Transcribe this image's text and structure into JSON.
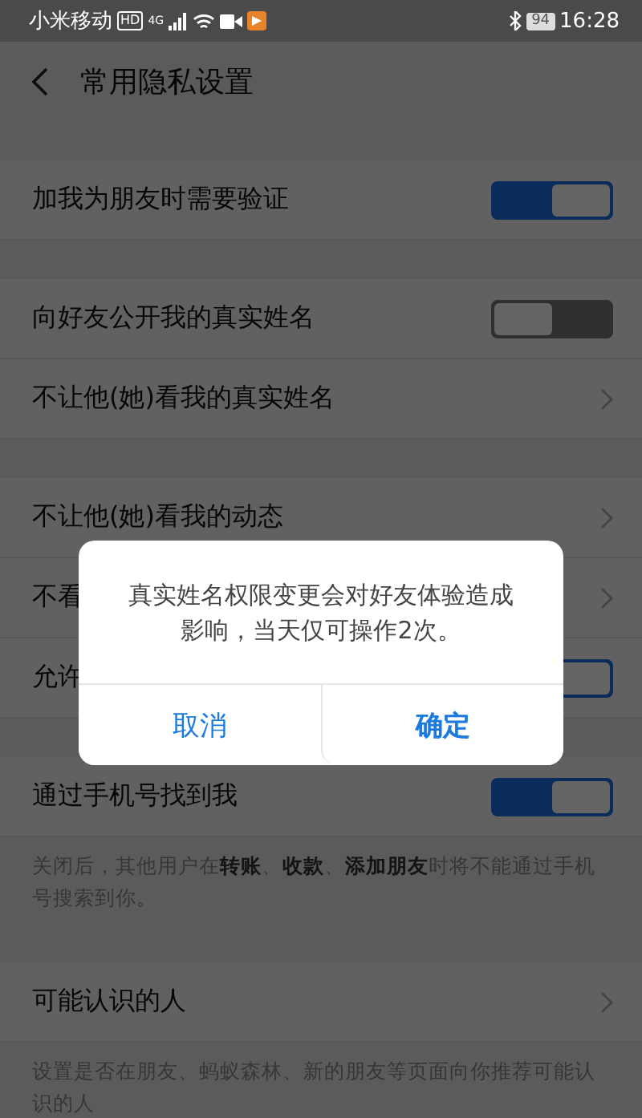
{
  "status_bar": {
    "carrier": "小米移动",
    "hd": "HD",
    "network": "4G",
    "battery": "94",
    "time": "16:28"
  },
  "header": {
    "title": "常用隐私设置"
  },
  "sections": [
    {
      "rows": [
        {
          "kind": "toggle",
          "label": "加我为朋友时需要验证",
          "on": true
        }
      ]
    },
    {
      "rows": [
        {
          "kind": "toggle",
          "label": "向好友公开我的真实姓名",
          "on": false
        },
        {
          "kind": "chevron",
          "label": "不让他(她)看我的真实姓名"
        }
      ]
    },
    {
      "rows": [
        {
          "kind": "chevron",
          "label": "不让他(她)看我的动态"
        },
        {
          "kind": "chevron",
          "label": "不看"
        },
        {
          "kind": "toggle",
          "label": "允许",
          "on": true
        }
      ]
    },
    {
      "rows": [
        {
          "kind": "toggle",
          "label": "通过手机号找到我",
          "on": true
        }
      ],
      "note": "关闭后，其他用户在**转账**、**收款**、**添加朋友**时将不能通过手机号搜索到你。"
    },
    {
      "rows": [
        {
          "kind": "chevron",
          "label": "可能认识的人"
        }
      ],
      "note": "设置是否在朋友、蚂蚁森林、新的朋友等页面向你推荐可能认识的人"
    }
  ],
  "dialog": {
    "message": "真实姓名权限变更会对好友体验造成影响，当天仅可操作2次。",
    "buttons": [
      {
        "label": "取消",
        "primary": false
      },
      {
        "label": "确定",
        "primary": true
      }
    ]
  }
}
